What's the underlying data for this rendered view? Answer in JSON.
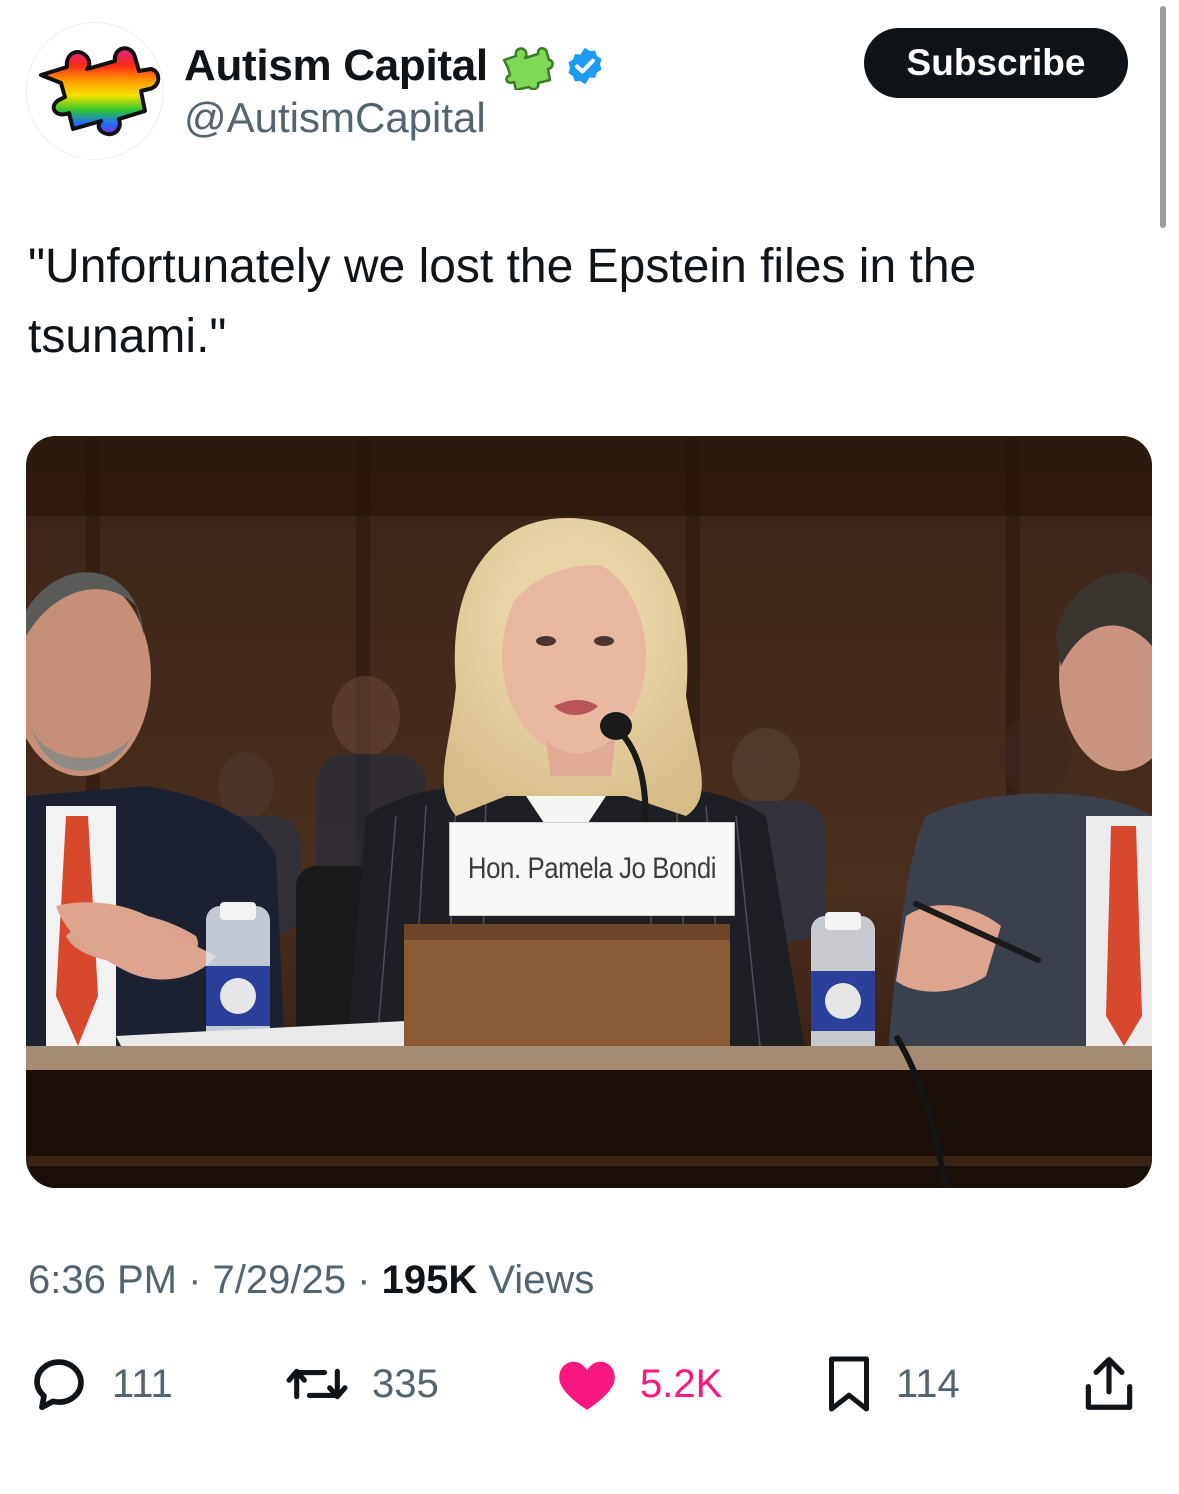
{
  "author": {
    "display_name": "Autism Capital",
    "handle": "@AutismCapital",
    "avatar_icon": "rainbow-puzzle-piece-icon",
    "name_badge_icon": "green-puzzle-piece-icon",
    "verified_icon": "verified-badge-icon"
  },
  "subscribe_label": "Subscribe",
  "tweet": {
    "text": "\"Unfortunately we lost the Epstein files in the tsunami.\""
  },
  "media": {
    "nameplate_text": "Hon. Pamela Jo Bondi"
  },
  "meta": {
    "time": "6:36 PM",
    "date": "7/29/25",
    "views_count": "195K",
    "views_label": "Views",
    "separator": "·"
  },
  "actions": {
    "replies": "111",
    "reposts": "335",
    "likes": "5.2K",
    "bookmarks": "114"
  },
  "colors": {
    "text_primary": "#0f1419",
    "text_secondary": "#536471",
    "like_active": "#f91880",
    "verified_blue": "#1d9bf0"
  }
}
